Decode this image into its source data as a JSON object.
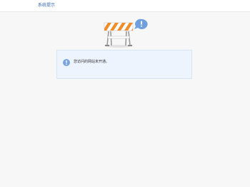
{
  "header": {
    "title": "系统提示"
  },
  "illustration": {
    "icon": "construction-barrier-icon",
    "alert_icon": "exclamation-bubble-icon"
  },
  "notice": {
    "icon": "info-icon",
    "message": "您访问的网站未开通。"
  },
  "colors": {
    "page_background": "#f7f7f7",
    "title": "#3366aa",
    "notice_background": "#eef4fe",
    "notice_border": "#d7e3f7",
    "accent": "#7aa5df",
    "barrier_orange": "#f28c28"
  }
}
